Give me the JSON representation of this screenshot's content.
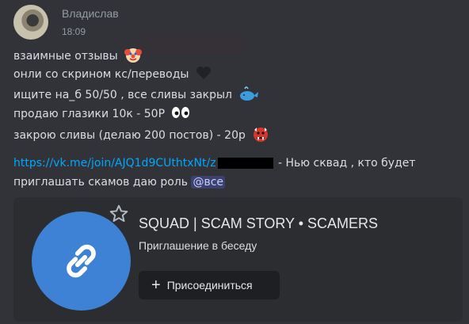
{
  "message": {
    "author": "Владислав",
    "timestamp": "18:09",
    "lines": [
      {
        "text": "взаимные отзывы",
        "emoji": "clown-face-icon"
      },
      {
        "text": "онли со скрином кс/переводы",
        "emoji": "black-heart-icon"
      },
      {
        "text": "ищите на_б 50/50 , все сливы закрыл",
        "emoji": "whale-icon"
      },
      {
        "text": "продаю глазики 10к - 50Р",
        "emoji": "eyes-icon"
      },
      {
        "text": "закрою сливы (делаю 200 постов) - 20р",
        "emoji": "ogre-face-icon"
      }
    ],
    "link": "https://vk.me/join/AJQ1d9CUthtxNt/z",
    "after_link": " - Нью сквад , кто будет",
    "line_last": "приглашать скамов даю роль ",
    "mention": "@все"
  },
  "embed": {
    "title": "SQUAD | SCAM STORY • SCAMERS",
    "subtitle": "Приглашение в беседу",
    "button_label": "Присоединиться",
    "circle_color": "#3e82d6"
  }
}
